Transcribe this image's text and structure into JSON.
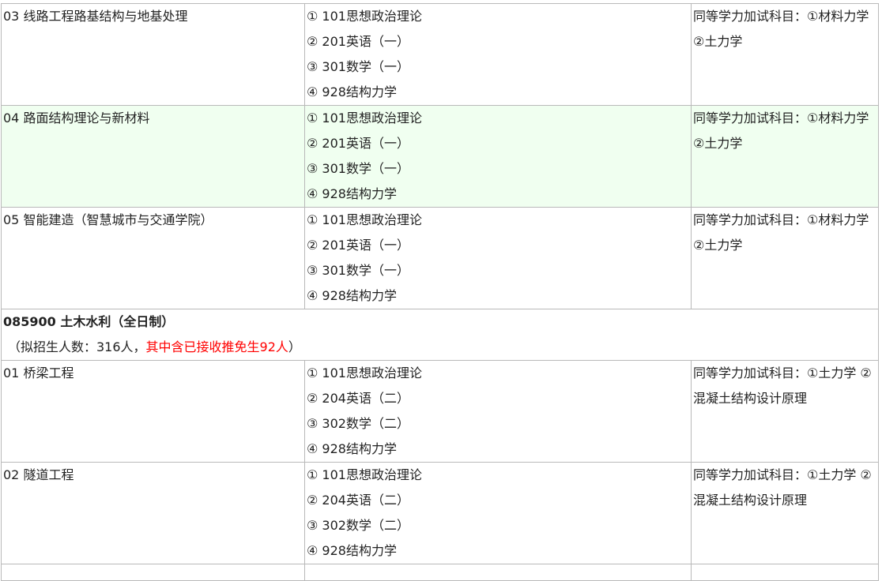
{
  "groups": [
    {
      "rows": [
        {
          "direction": "03 线路工程路基结构与地基处理",
          "subjects": [
            "① 101思想政治理论",
            "② 201英语（一）",
            "③ 301数学（一）",
            "④ 928结构力学"
          ],
          "note": "同等学力加试科目：①材料力学 ②土力学",
          "highlight": false
        },
        {
          "direction": "04 路面结构理论与新材料",
          "subjects": [
            "① 101思想政治理论",
            "② 201英语（一）",
            "③ 301数学（一）",
            "④ 928结构力学"
          ],
          "note": "同等学力加试科目：①材料力学 ②土力学",
          "highlight": true
        },
        {
          "direction": "05 智能建造（智慧城市与交通学院）",
          "subjects": [
            "① 101思想政治理论",
            "② 201英语（一）",
            "③ 301数学（一）",
            "④ 928结构力学"
          ],
          "note": "同等学力加试科目：①材料力学 ②土力学",
          "highlight": false
        }
      ]
    }
  ],
  "major": {
    "title": "085900 土木水利（全日制）",
    "quota_prefix": "（拟招生人数：316人，",
    "quota_highlight": "其中含已接收推免生92人",
    "quota_suffix": "）",
    "highlight_color": "#ff0000"
  },
  "rows2": [
    {
      "direction": "01 桥梁工程",
      "subjects": [
        "① 101思想政治理论",
        "② 204英语（二）",
        "③ 302数学（二）",
        "④ 928结构力学"
      ],
      "note": "同等学力加试科目：①土力学 ②混凝土结构设计原理"
    },
    {
      "direction": "02 隧道工程",
      "subjects": [
        "① 101思想政治理论",
        "② 204英语（二）",
        "③ 302数学（二）",
        "④ 928结构力学"
      ],
      "note": "同等学力加试科目：①土力学 ②混凝土结构设计原理"
    }
  ],
  "colors": {
    "border": "#b9b9b9",
    "highlight_row": "#f0fff0",
    "text": "#222222"
  }
}
